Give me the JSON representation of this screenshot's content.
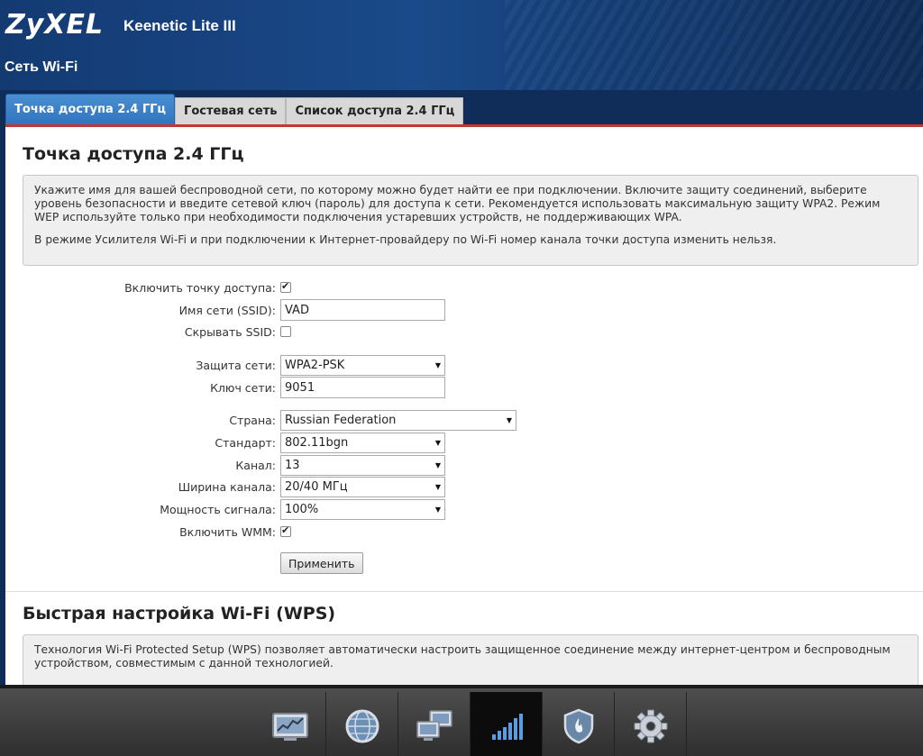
{
  "header": {
    "brand": "ZyXEL",
    "model": "Keenetic Lite III",
    "page_title": "Сеть Wi-Fi"
  },
  "tabs": [
    {
      "label": "Точка доступа 2.4 ГГц",
      "active": true
    },
    {
      "label": "Гостевая сеть",
      "active": false
    },
    {
      "label": "Список доступа 2.4 ГГц",
      "active": false
    }
  ],
  "ap_section": {
    "title": "Точка доступа 2.4 ГГц",
    "info_p1": "Укажите имя для вашей беспроводной сети, по которому можно будет найти ее при подключении. Включите защиту соединений, выберите уровень безопасности и введите сетевой ключ (пароль) для доступа к сети. Рекомендуется использовать максимальную защиту WPA2. Режим WEP используйте только при необходимости подключения устаревших устройств, не поддерживающих WPA.",
    "info_p2": "В режиме Усилителя Wi-Fi и при подключении к Интернет-провайдеру по Wi-Fi номер канала точки доступа изменить нельзя."
  },
  "form": {
    "enable_ap": {
      "label": "Включить точку доступа:",
      "checked": true
    },
    "ssid": {
      "label": "Имя сети (SSID):",
      "value": "VAD"
    },
    "hide_ssid": {
      "label": "Скрывать SSID:",
      "checked": false
    },
    "security": {
      "label": "Защита сети:",
      "value": "WPA2-PSK"
    },
    "key": {
      "label": "Ключ сети:",
      "value": "9051"
    },
    "country": {
      "label": "Страна:",
      "value": "Russian Federation"
    },
    "standard": {
      "label": "Стандарт:",
      "value": "802.11bgn"
    },
    "channel": {
      "label": "Канал:",
      "value": "13"
    },
    "width": {
      "label": "Ширина канала:",
      "value": "20/40 МГц"
    },
    "power": {
      "label": "Мощность сигнала:",
      "value": "100%"
    },
    "wmm": {
      "label": "Включить WMM:",
      "checked": true
    },
    "apply_label": "Применить"
  },
  "wps_section": {
    "title": "Быстрая настройка Wi-Fi (WPS)",
    "info": "Технология Wi-Fi Protected Setup (WPS) позволяет автоматически настроить защищенное соединение между интернет-центром и беспроводным устройством, совместимым с данной технологией."
  },
  "bottom_nav": [
    {
      "icon": "monitor-chart-icon"
    },
    {
      "icon": "globe-icon"
    },
    {
      "icon": "network-computers-icon"
    },
    {
      "icon": "wifi-signal-icon",
      "active": true
    },
    {
      "icon": "shield-icon"
    },
    {
      "icon": "gear-icon"
    }
  ],
  "colors": {
    "header_bg": "#143a72",
    "tab_active": "#2f74bf",
    "tab_rule": "#c23636",
    "nav_bg": "#3a3a3a"
  }
}
